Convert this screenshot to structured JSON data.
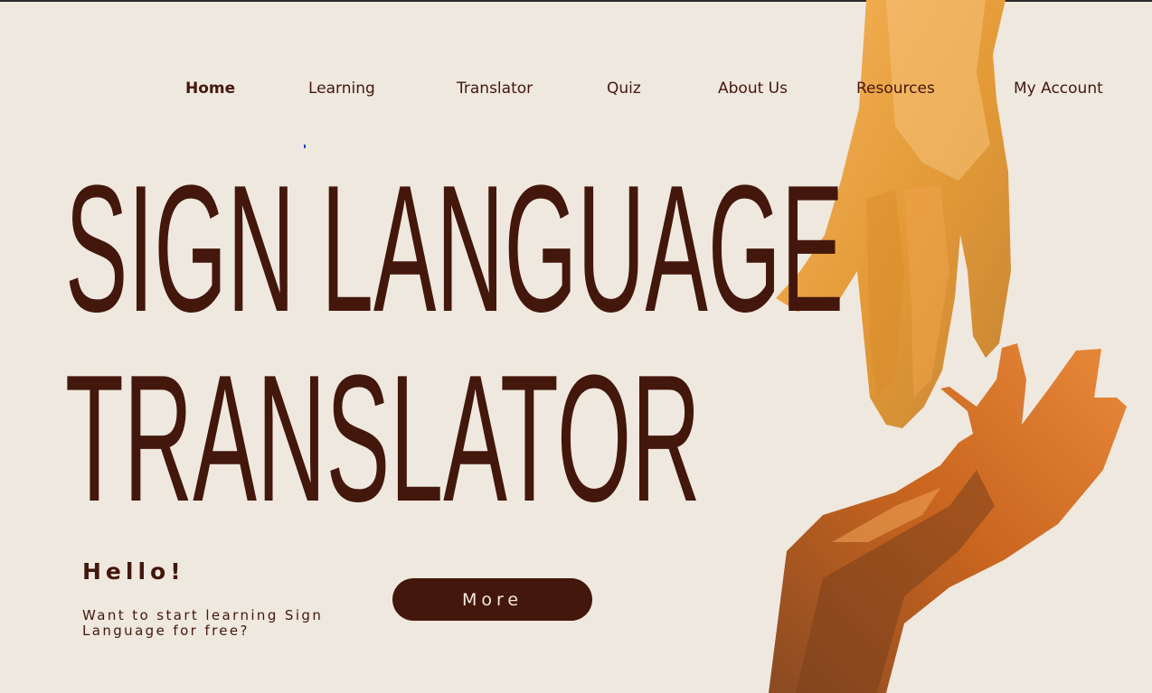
{
  "nav": {
    "items": [
      {
        "label": "Home",
        "active": true
      },
      {
        "label": "Learning"
      },
      {
        "label": "Translator"
      },
      {
        "label": "Quiz"
      },
      {
        "label": "About Us"
      },
      {
        "label": "Resources"
      },
      {
        "label": "My Account"
      }
    ]
  },
  "hero": {
    "line1": "SIGN LANGUAGE",
    "line2": "TRANSLATOR"
  },
  "intro": {
    "greeting": "Hello!",
    "tagline": "Want to start learning Sign Language for free?"
  },
  "cta": {
    "more_label": "More"
  },
  "colors": {
    "background": "#efe8df",
    "brand_dark": "#43170c",
    "hand_light": "#f0a43c",
    "hand_dark": "#c9601a"
  },
  "illustration": "hands-reaching-icon"
}
